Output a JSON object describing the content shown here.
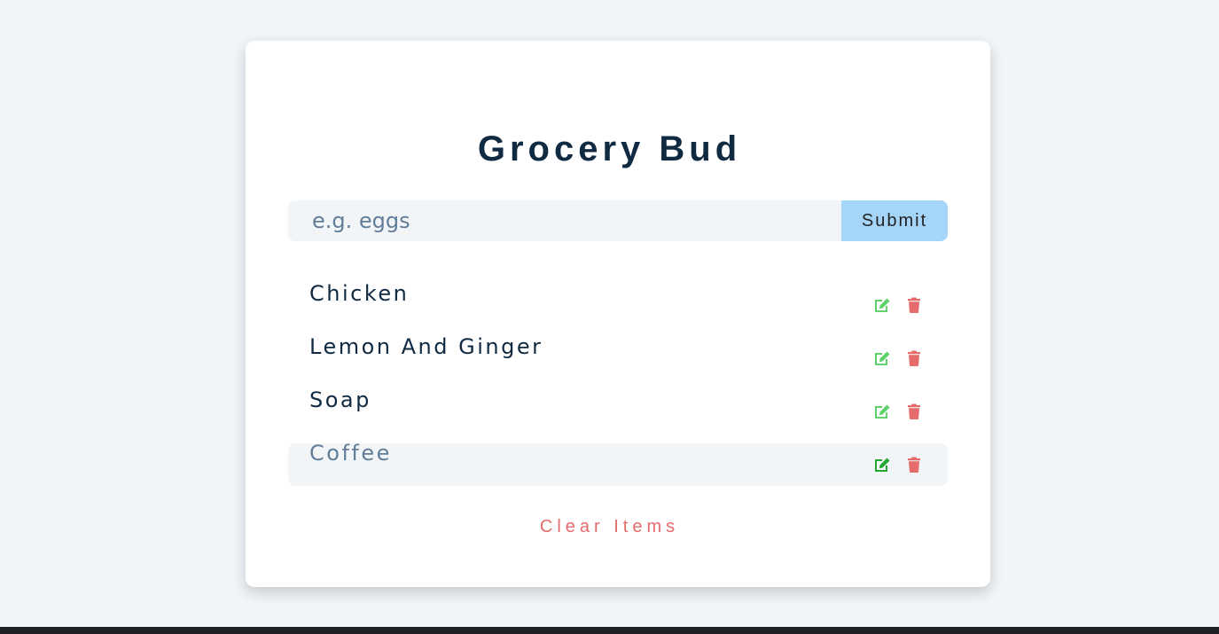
{
  "app": {
    "title": "Grocery Bud"
  },
  "form": {
    "placeholder": "e.g. eggs",
    "value": "",
    "submit_label": "Submit"
  },
  "items": [
    {
      "title": "Chicken",
      "active": false
    },
    {
      "title": "Lemon And Ginger",
      "active": false
    },
    {
      "title": "Soap",
      "active": false
    },
    {
      "title": "Coffee",
      "active": true
    }
  ],
  "clear_label": "Clear Items",
  "icons": {
    "edit": "edit-icon",
    "delete": "trash-icon"
  },
  "colors": {
    "background": "#f1f5f8",
    "card": "#ffffff",
    "title": "#102a42",
    "submit_bg": "#a5d5f8",
    "edit": "#5fd36b",
    "edit_active": "#22a733",
    "delete": "#e66b6b",
    "clear": "#e66b6b"
  }
}
